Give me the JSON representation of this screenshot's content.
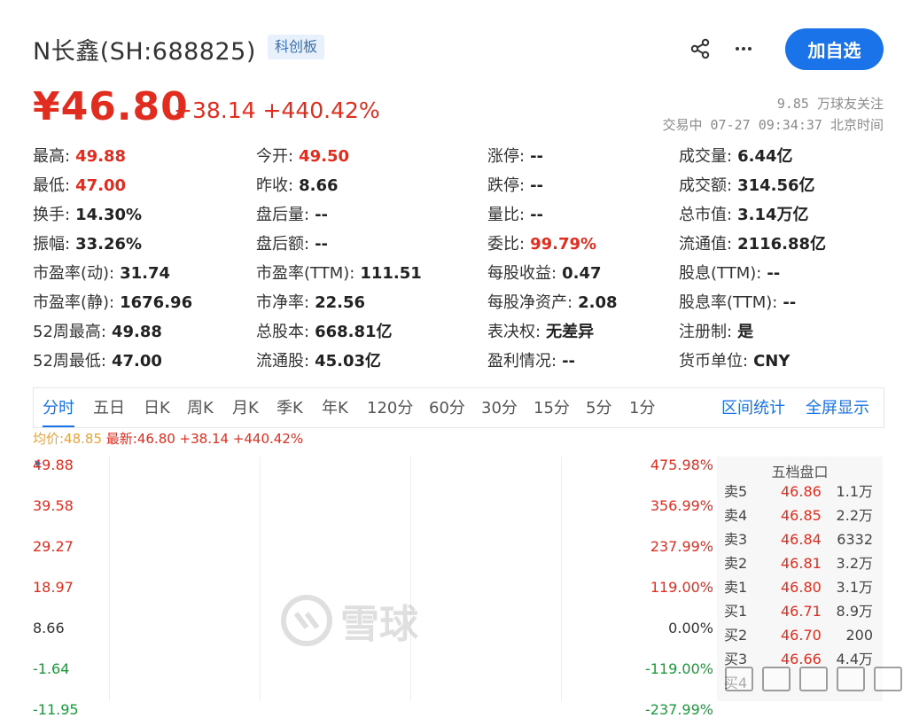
{
  "header": {
    "title": "N长鑫(SH:688825)",
    "badge": "科创板",
    "add_button": "加自选",
    "share_icon": "share-icon",
    "more_icon": "more-icon"
  },
  "quote": {
    "price": "¥46.80",
    "change": "+38.14 +440.42%",
    "followers": "9.85 万球友关注",
    "status_time": "交易中 07-27 09:34:37 北京时间"
  },
  "stats": [
    [
      {
        "label": "最高:",
        "value": "49.88",
        "color": "up"
      },
      {
        "label": "今开:",
        "value": "49.50",
        "color": "up"
      },
      {
        "label": "涨停:",
        "value": "--",
        "color": ""
      },
      {
        "label": "成交量:",
        "value": "6.44亿",
        "color": ""
      }
    ],
    [
      {
        "label": "最低:",
        "value": "47.00",
        "color": "up"
      },
      {
        "label": "昨收:",
        "value": "8.66",
        "color": ""
      },
      {
        "label": "跌停:",
        "value": "--",
        "color": ""
      },
      {
        "label": "成交额:",
        "value": "314.56亿",
        "color": ""
      }
    ],
    [
      {
        "label": "换手:",
        "value": "14.30%",
        "color": ""
      },
      {
        "label": "盘后量:",
        "value": "--",
        "color": ""
      },
      {
        "label": "量比:",
        "value": "--",
        "color": ""
      },
      {
        "label": "总市值:",
        "value": "3.14万亿",
        "color": ""
      }
    ],
    [
      {
        "label": "振幅:",
        "value": "33.26%",
        "color": ""
      },
      {
        "label": "盘后额:",
        "value": "--",
        "color": ""
      },
      {
        "label": "委比:",
        "value": "99.79%",
        "color": "up"
      },
      {
        "label": "流通值:",
        "value": "2116.88亿",
        "color": ""
      }
    ],
    [
      {
        "label": "市盈率(动):",
        "value": "31.74",
        "color": ""
      },
      {
        "label": "市盈率(TTM):",
        "value": "111.51",
        "color": ""
      },
      {
        "label": "每股收益:",
        "value": "0.47",
        "color": ""
      },
      {
        "label": "股息(TTM):",
        "value": "--",
        "color": ""
      }
    ],
    [
      {
        "label": "市盈率(静):",
        "value": "1676.96",
        "color": ""
      },
      {
        "label": "市净率:",
        "value": "22.56",
        "color": ""
      },
      {
        "label": "每股净资产:",
        "value": "2.08",
        "color": ""
      },
      {
        "label": "股息率(TTM):",
        "value": "--",
        "color": ""
      }
    ],
    [
      {
        "label": "52周最高:",
        "value": "49.88",
        "color": ""
      },
      {
        "label": "总股本:",
        "value": "668.81亿",
        "color": ""
      },
      {
        "label": "表决权:",
        "value": "无差异",
        "color": ""
      },
      {
        "label": "注册制:",
        "value": "是",
        "color": ""
      }
    ],
    [
      {
        "label": "52周最低:",
        "value": "47.00",
        "color": ""
      },
      {
        "label": "流通股:",
        "value": "45.03亿",
        "color": ""
      },
      {
        "label": "盈利情况:",
        "value": "--",
        "color": ""
      },
      {
        "label": "货币单位:",
        "value": "CNY",
        "color": ""
      }
    ]
  ],
  "tabs": [
    "分时",
    "五日",
    "日K",
    "周K",
    "月K",
    "季K",
    "年K",
    "120分",
    "60分",
    "30分",
    "15分",
    "5分",
    "1分"
  ],
  "tab_links": [
    "区间统计",
    "全屏显示"
  ],
  "summary": {
    "avg": "均价:48.85",
    "latest": "最新:46.80 +38.14 +440.42%"
  },
  "chart": {
    "left_labels": [
      "49.88",
      "39.58",
      "29.27",
      "18.97",
      "8.66",
      "-1.64",
      "-11.95"
    ],
    "right_labels": [
      "475.98%",
      "356.99%",
      "237.99%",
      "119.00%",
      "0.00%",
      "-119.00%",
      "-237.99%"
    ],
    "colors": {
      "up": "#e02d20",
      "neutral": "#333333",
      "down": "#1a9a3a"
    }
  },
  "order_book": {
    "title": "五档盘口",
    "rows": [
      {
        "label": "卖5",
        "price": "46.86",
        "vol": "1.1万"
      },
      {
        "label": "卖4",
        "price": "46.85",
        "vol": "2.2万"
      },
      {
        "label": "卖3",
        "price": "46.84",
        "vol": "6332"
      },
      {
        "label": "卖2",
        "price": "46.81",
        "vol": "3.2万"
      },
      {
        "label": "卖1",
        "price": "46.80",
        "vol": "3.1万"
      },
      {
        "label": "买1",
        "price": "46.71",
        "vol": "8.9万"
      },
      {
        "label": "买2",
        "price": "46.70",
        "vol": "200"
      },
      {
        "label": "买3",
        "price": "46.66",
        "vol": "4.4万"
      },
      {
        "label": "买4",
        "price": "",
        "vol": ""
      }
    ]
  },
  "watermark": {
    "text": "雪球"
  }
}
